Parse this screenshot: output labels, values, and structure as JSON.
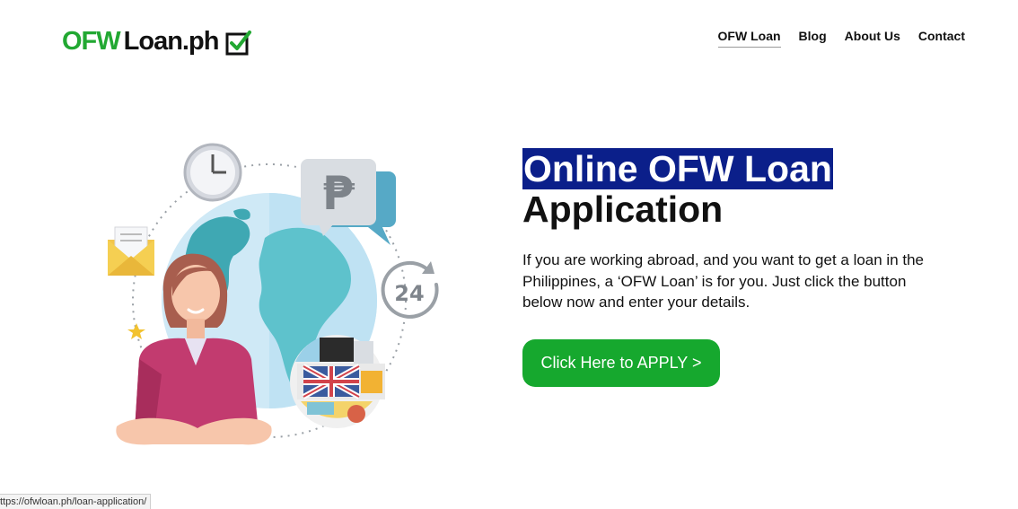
{
  "header": {
    "logo_ofw": "OFW",
    "logo_rest": "Loan.ph",
    "nav": [
      {
        "label": "OFW Loan",
        "active": true
      },
      {
        "label": "Blog",
        "active": false
      },
      {
        "label": "About Us",
        "active": false
      },
      {
        "label": "Contact",
        "active": false
      }
    ]
  },
  "hero": {
    "title_highlight": "Online OFW Loan",
    "title_rest": "Application",
    "description": "If you are working abroad, and you want to get a loan in the Philippines, a ‘OFW Loan’ is for you. Just click the button below now and enter your details.",
    "apply_label": "Click Here to APPLY >"
  },
  "illustration": {
    "peso_symbol": "₱",
    "clock_badge": "24"
  },
  "statusbar": {
    "url": "ttps://ofwloan.ph/loan-application/"
  },
  "colors": {
    "brand_green": "#22a832",
    "button_green": "#16a82e",
    "highlight_blue": "#0b1f8a"
  }
}
